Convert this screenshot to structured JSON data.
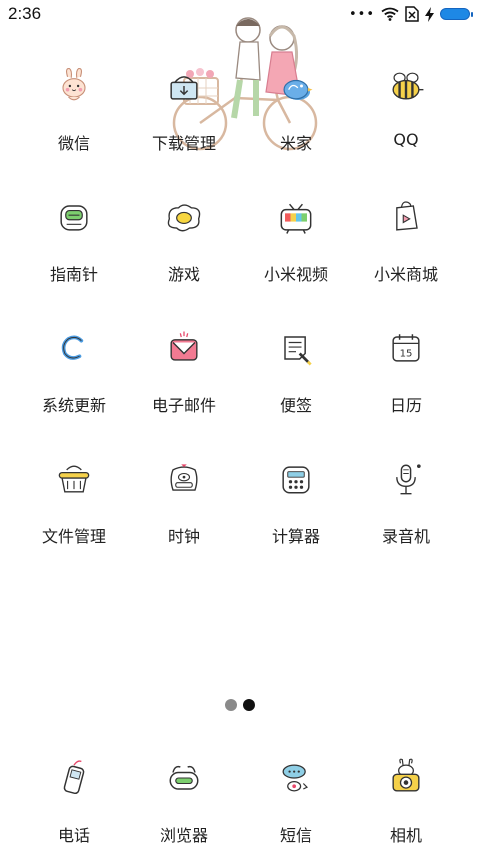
{
  "status_bar": {
    "time": "2:36",
    "more_dots": "•••"
  },
  "apps": [
    {
      "label": "微信",
      "icon": "bunny-face-icon"
    },
    {
      "label": "下载管理",
      "icon": "basket-download-icon"
    },
    {
      "label": "米家",
      "icon": "bird-icon"
    },
    {
      "label": "QQ",
      "icon": "bee-icon"
    },
    {
      "label": "指南针",
      "icon": "compass-icon"
    },
    {
      "label": "游戏",
      "icon": "egg-icon"
    },
    {
      "label": "小米视频",
      "icon": "tv-icon"
    },
    {
      "label": "小米商城",
      "icon": "shopping-bag-icon"
    },
    {
      "label": "系统更新",
      "icon": "refresh-icon"
    },
    {
      "label": "电子邮件",
      "icon": "mail-icon"
    },
    {
      "label": "便签",
      "icon": "note-pencil-icon"
    },
    {
      "label": "日历",
      "icon": "calendar-icon"
    },
    {
      "label": "文件管理",
      "icon": "basket-folder-icon"
    },
    {
      "label": "时钟",
      "icon": "alarm-clock-icon"
    },
    {
      "label": "计算器",
      "icon": "calculator-icon"
    },
    {
      "label": "录音机",
      "icon": "microphone-icon"
    }
  ],
  "calendar_day": "15",
  "dock": [
    {
      "label": "电话",
      "icon": "phone-icon"
    },
    {
      "label": "浏览器",
      "icon": "browser-icon"
    },
    {
      "label": "短信",
      "icon": "message-bubble-icon"
    },
    {
      "label": "相机",
      "icon": "camera-icon"
    }
  ],
  "page_indicator": {
    "pages": 2,
    "active": 2
  },
  "colors": {
    "accent_pink": "#e8486a",
    "accent_yellow": "#f5d14a",
    "line": "#333333",
    "battery": "#1e88e5"
  }
}
